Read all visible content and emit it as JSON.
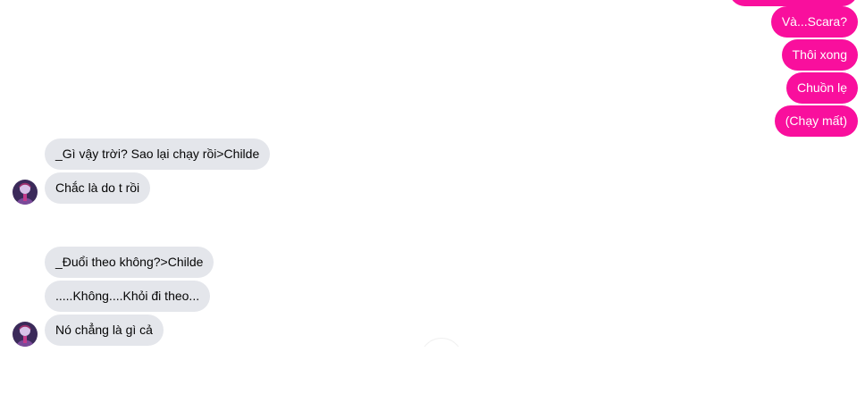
{
  "sent_messages": [
    {
      "text": "Và...Scara?"
    },
    {
      "text": "Thôi xong"
    },
    {
      "text": "Chuồn lẹ"
    },
    {
      "text": "(Chạy mất)"
    }
  ],
  "received_groups": [
    {
      "messages": [
        {
          "text": "_Gì vậy trời? Sao lại chạy rồi>Childe"
        },
        {
          "text": "Chắc là do t rồi"
        }
      ]
    },
    {
      "messages": [
        {
          "text": "_Đuổi theo không?>Childe"
        },
        {
          "text": ".....Không....Khỏi đi theo..."
        },
        {
          "text": "Nó chẳng là gì cả"
        }
      ]
    }
  ],
  "colors": {
    "sent_bubble": "#f90f9d",
    "received_bubble": "#e4e6eb",
    "background": "#ffffff"
  },
  "icons": {
    "avatar": "contact-avatar"
  }
}
